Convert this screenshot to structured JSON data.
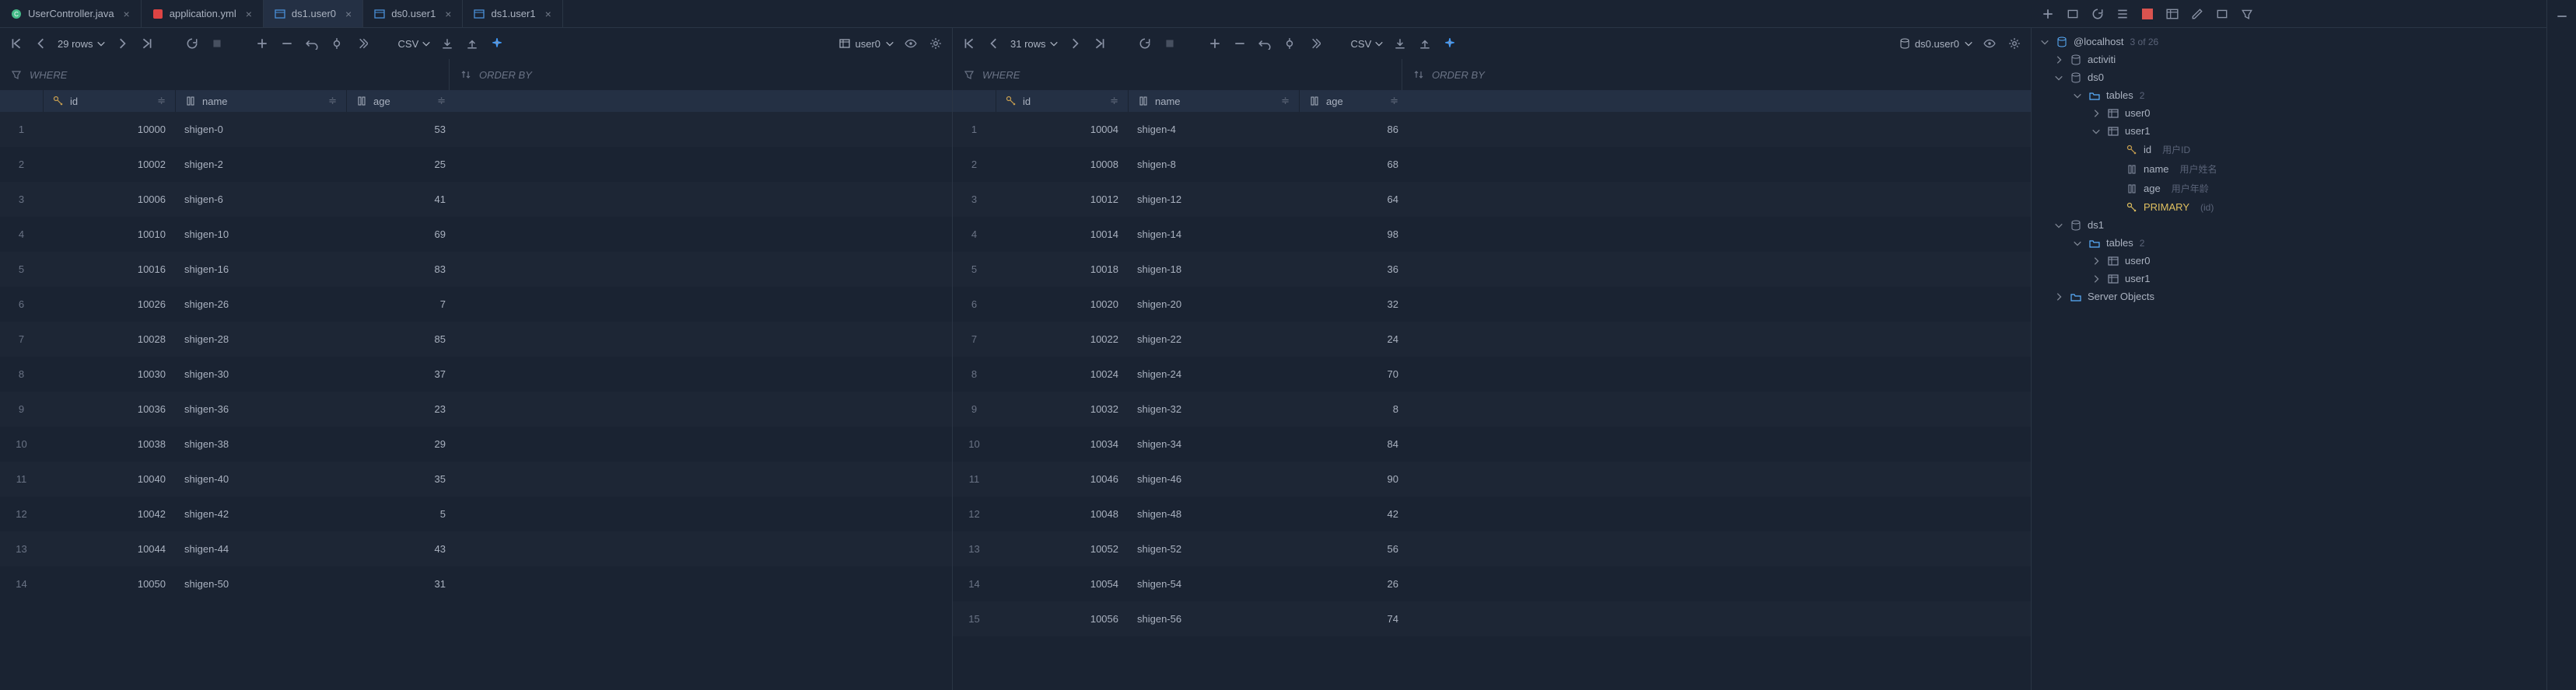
{
  "tabs": [
    {
      "label": "UserController.java",
      "icon": "java",
      "active": false
    },
    {
      "label": "application.yml",
      "icon": "yaml",
      "active": false
    },
    {
      "label": "ds1.user0",
      "icon": "table",
      "active": true
    },
    {
      "label": "ds0.user1",
      "icon": "table",
      "active": false
    },
    {
      "label": "ds1.user1",
      "icon": "table",
      "active": false
    }
  ],
  "left_pane": {
    "rows_label": "29 rows",
    "export_label": "CSV",
    "tx_label": "user0",
    "where": "WHERE",
    "orderby": "ORDER BY",
    "columns": [
      "id",
      "name",
      "age"
    ],
    "data": [
      {
        "id": 10000,
        "name": "shigen-0",
        "age": 53
      },
      {
        "id": 10002,
        "name": "shigen-2",
        "age": 25
      },
      {
        "id": 10006,
        "name": "shigen-6",
        "age": 41
      },
      {
        "id": 10010,
        "name": "shigen-10",
        "age": 69
      },
      {
        "id": 10016,
        "name": "shigen-16",
        "age": 83
      },
      {
        "id": 10026,
        "name": "shigen-26",
        "age": 7
      },
      {
        "id": 10028,
        "name": "shigen-28",
        "age": 85
      },
      {
        "id": 10030,
        "name": "shigen-30",
        "age": 37
      },
      {
        "id": 10036,
        "name": "shigen-36",
        "age": 23
      },
      {
        "id": 10038,
        "name": "shigen-38",
        "age": 29
      },
      {
        "id": 10040,
        "name": "shigen-40",
        "age": 35
      },
      {
        "id": 10042,
        "name": "shigen-42",
        "age": 5
      },
      {
        "id": 10044,
        "name": "shigen-44",
        "age": 43
      },
      {
        "id": 10050,
        "name": "shigen-50",
        "age": 31
      }
    ]
  },
  "right_pane": {
    "rows_label": "31 rows",
    "export_label": "CSV",
    "where": "WHERE",
    "orderby": "ORDER BY",
    "columns": [
      "id",
      "name",
      "age"
    ],
    "data": [
      {
        "id": 10004,
        "name": "shigen-4",
        "age": 86
      },
      {
        "id": 10008,
        "name": "shigen-8",
        "age": 68
      },
      {
        "id": 10012,
        "name": "shigen-12",
        "age": 64
      },
      {
        "id": 10014,
        "name": "shigen-14",
        "age": 98
      },
      {
        "id": 10018,
        "name": "shigen-18",
        "age": 36
      },
      {
        "id": 10020,
        "name": "shigen-20",
        "age": 32
      },
      {
        "id": 10022,
        "name": "shigen-22",
        "age": 24
      },
      {
        "id": 10024,
        "name": "shigen-24",
        "age": 70
      },
      {
        "id": 10032,
        "name": "shigen-32",
        "age": 8
      },
      {
        "id": 10034,
        "name": "shigen-34",
        "age": 84
      },
      {
        "id": 10046,
        "name": "shigen-46",
        "age": 90
      },
      {
        "id": 10048,
        "name": "shigen-48",
        "age": 42
      },
      {
        "id": 10052,
        "name": "shigen-52",
        "age": 56
      },
      {
        "id": 10054,
        "name": "shigen-54",
        "age": 26
      },
      {
        "id": 10056,
        "name": "shigen-56",
        "age": 74
      }
    ]
  },
  "db_toolbar": {
    "source": "ds0.user0"
  },
  "tree": {
    "root": "@localhost",
    "root_badge": "3 of 26",
    "nodes": [
      {
        "depth": 1,
        "icon": "schema",
        "label": "activiti",
        "expand": "closed"
      },
      {
        "depth": 1,
        "icon": "schema",
        "label": "ds0",
        "expand": "open"
      },
      {
        "depth": 2,
        "icon": "folder",
        "label": "tables",
        "badge": "2",
        "expand": "open"
      },
      {
        "depth": 3,
        "icon": "table",
        "label": "user0",
        "expand": "closed"
      },
      {
        "depth": 3,
        "icon": "table",
        "label": "user1",
        "expand": "open"
      },
      {
        "depth": 4,
        "icon": "key-col",
        "label": "id",
        "comment": "用户ID"
      },
      {
        "depth": 4,
        "icon": "col",
        "label": "name",
        "comment": "用户姓名"
      },
      {
        "depth": 4,
        "icon": "col",
        "label": "age",
        "comment": "用户年龄"
      },
      {
        "depth": 4,
        "icon": "pk",
        "label": "PRIMARY",
        "comment": "(id)",
        "pk": true
      },
      {
        "depth": 1,
        "icon": "schema",
        "label": "ds1",
        "expand": "open"
      },
      {
        "depth": 2,
        "icon": "folder",
        "label": "tables",
        "badge": "2",
        "expand": "open"
      },
      {
        "depth": 3,
        "icon": "table",
        "label": "user0",
        "expand": "closed"
      },
      {
        "depth": 3,
        "icon": "table",
        "label": "user1",
        "expand": "closed"
      },
      {
        "depth": 1,
        "icon": "folder",
        "label": "Server Objects",
        "expand": "closed"
      }
    ]
  }
}
